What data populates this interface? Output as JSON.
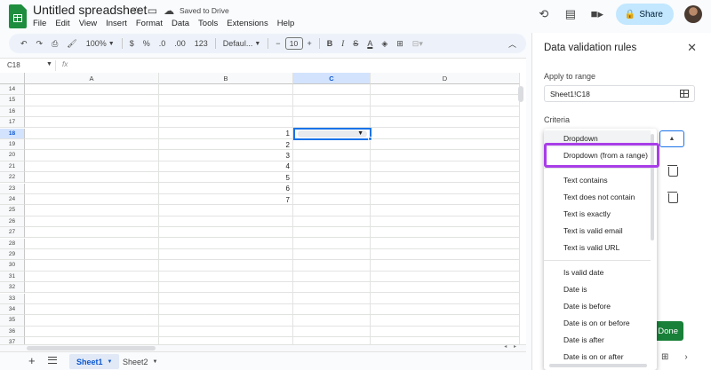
{
  "document": {
    "title": "Untitled spreadsheet",
    "saved_status": "Saved to Drive"
  },
  "menubar": [
    "File",
    "Edit",
    "View",
    "Insert",
    "Format",
    "Data",
    "Tools",
    "Extensions",
    "Help"
  ],
  "header": {
    "share_label": "Share"
  },
  "toolbar": {
    "zoom": "100%",
    "currency": "$",
    "percent": "%",
    "decrease_decimal": ".0",
    "increase_decimal": ".00",
    "number_format": "123",
    "font": "Defaul...",
    "minus": "−",
    "font_size": "10",
    "plus": "+",
    "bold": "B",
    "italic": "I"
  },
  "formula_bar": {
    "cell_reference": "C18",
    "fx_label": "fx"
  },
  "grid": {
    "columns": [
      "A",
      "B",
      "C",
      "D"
    ],
    "rows": [
      "14",
      "15",
      "16",
      "17",
      "18",
      "19",
      "20",
      "21",
      "22",
      "23",
      "24",
      "25",
      "26",
      "27",
      "28",
      "29",
      "30",
      "31",
      "32",
      "33",
      "34",
      "35",
      "36",
      "37"
    ],
    "selected_row": "18",
    "selected_column": "C",
    "column_b_values": [
      {
        "row": "18",
        "value": "1"
      },
      {
        "row": "19",
        "value": "2"
      },
      {
        "row": "20",
        "value": "3"
      },
      {
        "row": "21",
        "value": "4"
      },
      {
        "row": "22",
        "value": "5"
      },
      {
        "row": "23",
        "value": "6"
      },
      {
        "row": "24",
        "value": "7"
      }
    ]
  },
  "sheet_tabs": {
    "tabs": [
      "Sheet1",
      "Sheet2"
    ],
    "active": "Sheet1"
  },
  "panel": {
    "title": "Data validation rules",
    "apply_to_range_label": "Apply to range",
    "range_value": "Sheet1!C18",
    "criteria_label": "Criteria",
    "done_label": "Done"
  },
  "criteria_menu": {
    "groups": [
      [
        "Dropdown",
        "Dropdown (from a range)"
      ],
      [
        "Text contains",
        "Text does not contain",
        "Text is exactly",
        "Text is valid email",
        "Text is valid URL"
      ],
      [
        "Is valid date",
        "Date is",
        "Date is before",
        "Date is on or before",
        "Date is after",
        "Date is on or after"
      ]
    ],
    "highlighted_item": "Dropdown (from a range)"
  },
  "colors": {
    "accent": "#1a73e8",
    "highlight_outline": "#a93ee8",
    "done_button": "#188038",
    "share_button": "#c2e7ff",
    "sheets_green": "#1e8e3e"
  }
}
